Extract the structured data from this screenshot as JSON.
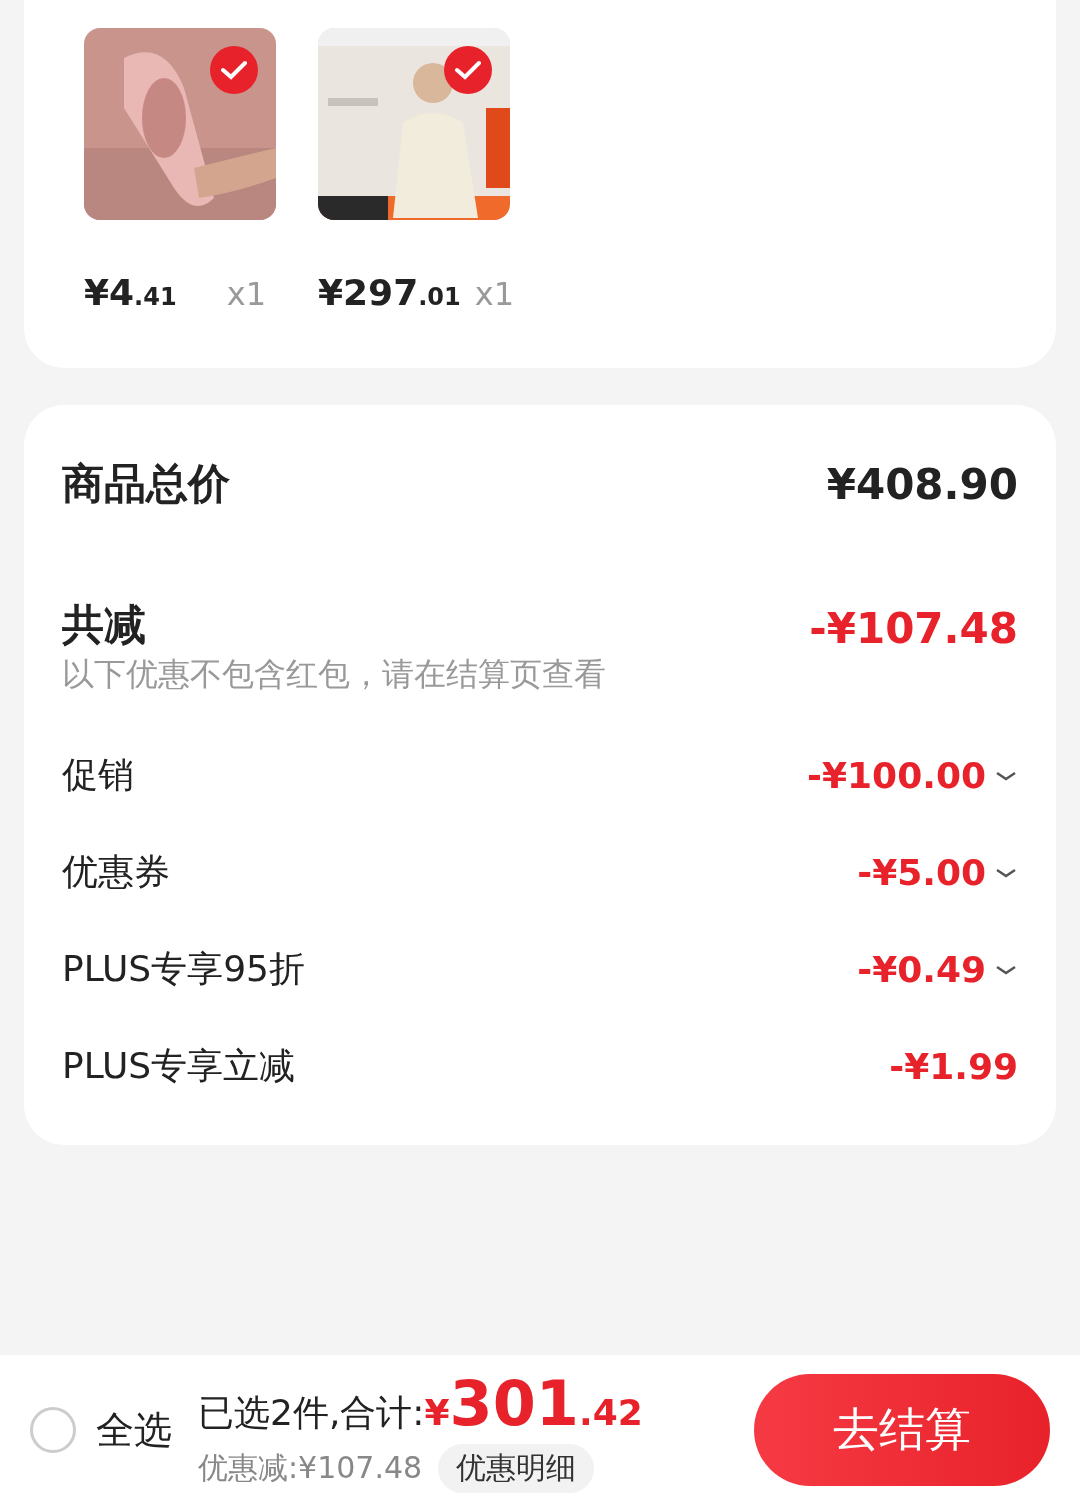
{
  "products": [
    {
      "kind": "picture",
      "selected": true,
      "price_main": "¥4",
      "price_decimal": ".41",
      "quantity": "x1"
    },
    {
      "kind": "picture",
      "selected": true,
      "price_main": "¥297",
      "price_decimal": ".01",
      "quantity": "x1"
    }
  ],
  "summary": {
    "total_label": "商品总价",
    "total_value": "¥408.90",
    "discount_label": "共减",
    "discount_value": "-¥107.48",
    "note": "以下优惠不包含红包，请在结算页查看",
    "rows": [
      {
        "label": "促销",
        "value": "-¥100.00",
        "expandable": true
      },
      {
        "label": "优惠券",
        "value": "-¥5.00",
        "expandable": true
      },
      {
        "label": "PLUS专享95折",
        "value": "-¥0.49",
        "expandable": true
      },
      {
        "label": "PLUS专享立减",
        "value": "-¥1.99",
        "expandable": false
      }
    ]
  },
  "bottom_bar": {
    "select_all": {
      "label": "全选",
      "checked": false
    },
    "selected_text": "已选2件,合计:",
    "currency": "¥",
    "total_main": "301",
    "total_decimal": ".42",
    "saving_text": "优惠减:¥107.48",
    "details_button": "优惠明细",
    "checkout_button": "去结算"
  }
}
